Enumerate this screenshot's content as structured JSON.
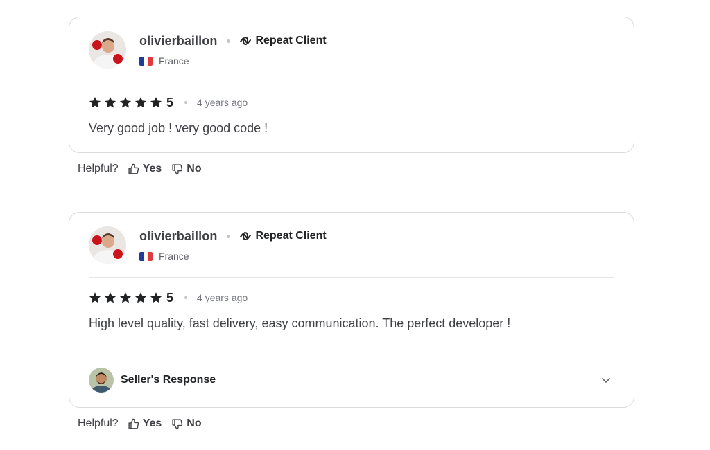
{
  "reviews": [
    {
      "username": "olivierbaillon",
      "badge": "Repeat Client",
      "country": "France",
      "rating": "5",
      "stars": 5,
      "time": "4 years ago",
      "text": "Very good job ! very good code !",
      "has_response": false
    },
    {
      "username": "olivierbaillon",
      "badge": "Repeat Client",
      "country": "France",
      "rating": "5",
      "stars": 5,
      "time": "4 years ago",
      "text": "High level quality, fast delivery, easy communication. The perfect developer !",
      "has_response": true,
      "response_label": "Seller's Response"
    }
  ],
  "helpful": {
    "label": "Helpful?",
    "yes": "Yes",
    "no": "No"
  },
  "colors": {
    "text_primary": "#222325",
    "text_secondary": "#62646a",
    "border": "#dadbdd",
    "flag_blue": "#1f3c99",
    "flag_red": "#e0393e"
  },
  "icons": {
    "repeat": "repeat-icon",
    "star": "star-icon",
    "thumbs_up": "thumbs-up-icon",
    "thumbs_down": "thumbs-down-icon",
    "chevron": "chevron-down-icon"
  }
}
